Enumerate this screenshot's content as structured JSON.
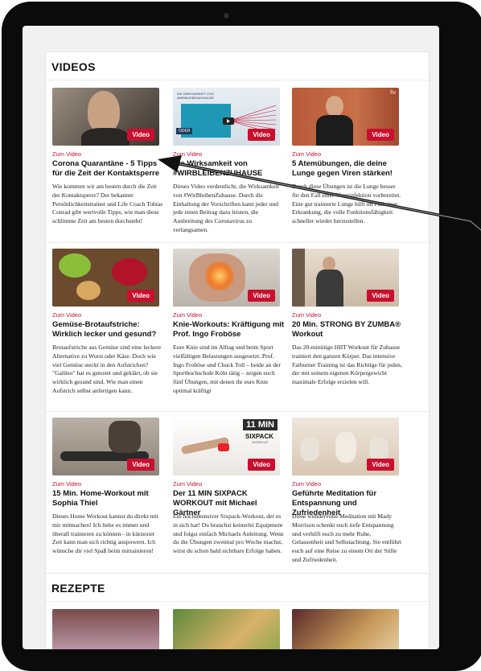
{
  "videos": {
    "heading": "VIDEOS",
    "badge": "Video",
    "kicker": "Zum Video",
    "cards": [
      {
        "title": "Corona Quarantäne - 5 Tipps für die Zeit der Kontaktsperre",
        "desc": "Wie kommen wir am besten durch die Zeit der Kontaktsperre? Der bekannte Persönlichkeitstrainer und Life Coach Tobias Conrad gibt wertvolle Tipps, wie man diese schlimme Zeit am besten durchsteht!"
      },
      {
        "title": "Die Wirksamkeit von #WIRBLEIBENZUHAUSE",
        "desc": "Dieses Video verdeutlicht, die Wirksamkeit von #WirBleibenZuhause. Durch die Einhaltung der Vorschriften kann jeder und jede einen Beitrag dazu leisten, die Ausbreitung des Coronavirus zu verlangsamen.",
        "thumb_text": "DIE WIRKSAMKEIT VON #WIRBLEIBENZUHAUSE",
        "thumb_tag": "ODER"
      },
      {
        "title": "5 Atemübungen, die deine Lunge gegen Viren stärken!",
        "desc": "Durch diese Übungen ist die Lunge besser für den Fall einer Vireninfektion vorbereitet. Eine gut trainierte Lunge hilft im Fall einer Erkrankung, die volle Funktionsfähigkeit schneller wieder herzustellen.",
        "thumb_logo": "fiv"
      },
      {
        "title": "Gemüse-Brotaufstriche: Wirklich lecker und gesund?",
        "desc": "Brotaufstriche aus Gemüse sind eine leckere Alternative zu Wurst oder Käse. Doch wie viel Gemüse steckt in den Aufstrichen? \"Galileo\" hat es getestet und geklärt, ob sie wirklich gesund sind. Wie man einen Aufstrich selbst anfertigen kann."
      },
      {
        "title": "Knie-Workouts: Kräftigung mit Prof. Ingo Froböse",
        "desc": "Eure Knie sind im Alltag und beim Sport vielfältigen Belastungen ausgesetzt. Prof. Ingo Froböse und Chuck Toll – beide an der Sporthochschule Köln tätig – zeigen euch fünf Übungen, mit denen ihr eure Knie optimal kräftigt"
      },
      {
        "title": "20 Min. STRONG BY ZUMBA® Workout",
        "desc": "Das 20-minütige HIIT Workout für Zuhause trainiert den ganzen Körper. Das intensive Fatburner Training ist das Richtige für jeden, der mit seinem eigenen Körpergewicht maximale Erfolge erzielen will."
      },
      {
        "title": "15 Min. Home-Workout mit Sophia Thiel",
        "desc": "Dieses Home Workout kannst du direkt mit mir mitmachen! Ich liebe es immer und überall trainieren zu können - in kürzester Zeit kann man sich richtig auspowern. Ich wünsche dir viel Spaß beim mitrainieren!"
      },
      {
        "title": "Der 11 MIN SIXPACK WORKOUT mit Michael Gärtner",
        "desc": "Ein hochintensiver Sixpack-Workout, der es in sich hat! Du brauchst keinerlei Equipment und folgst einfach Michaels Anleitung. Wenn du die Übungen zweimal pro Woche machst, wirst du schon bald sichtbare Erfolge haben.",
        "thumb_big": "11 MIN",
        "thumb_small": "SIXPACK",
        "thumb_tiny": "WORKOUT"
      },
      {
        "title": "Geführte Meditation für Entspannung und Zufriedenheit",
        "desc": "Diese wundervolle Meditation mit Mady Morrison schenkt euch tiefe Entspannung und verhilft euch zu mehr Ruhe, Gelassenheit und Selbstachtung. Sie entführt euch auf eine Reise zu einem Ort der Stille und Zufriedenheit."
      }
    ]
  },
  "rezepte": {
    "heading": "REZEPTE"
  },
  "colors": {
    "accent": "#c8102e",
    "frame": "#0b0b0b",
    "screen_bg": "#f1f1f1"
  }
}
